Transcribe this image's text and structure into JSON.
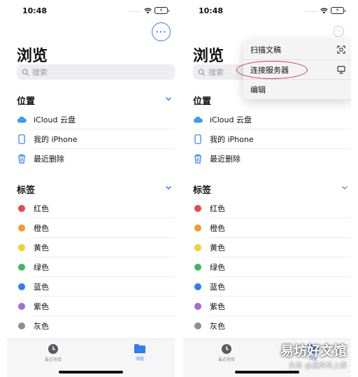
{
  "status_bar": {
    "time": "10:48",
    "signal_dots": "....."
  },
  "header": {
    "title": "浏览"
  },
  "search": {
    "placeholder": "搜索"
  },
  "locations": {
    "title": "位置",
    "items": [
      {
        "label": "iCloud 云盘",
        "icon": "cloud-icon"
      },
      {
        "label": "我的 iPhone",
        "icon": "phone-icon"
      },
      {
        "label": "最近删除",
        "icon": "trash-icon"
      }
    ]
  },
  "tags": {
    "title": "标签",
    "items": [
      {
        "label": "红色",
        "color": "#e84a4a"
      },
      {
        "label": "橙色",
        "color": "#f39a2b"
      },
      {
        "label": "黄色",
        "color": "#f5cf2a"
      },
      {
        "label": "绿色",
        "color": "#3fba5a"
      },
      {
        "label": "蓝色",
        "color": "#2f7cf6"
      },
      {
        "label": "紫色",
        "color": "#a46bd6"
      },
      {
        "label": "灰色",
        "color": "#8e8e93"
      }
    ]
  },
  "tabbar": {
    "recent_label": "最近项目",
    "browse_label": "浏览"
  },
  "menu": {
    "items": [
      {
        "label": "扫描文稿",
        "icon": "scan-icon"
      },
      {
        "label": "连接服务器",
        "icon": "monitor-icon"
      },
      {
        "label": "编辑"
      }
    ]
  },
  "watermark": {
    "main": "易坊好文馆",
    "sub": "头条 @品码马上修"
  },
  "colors": {
    "accent": "#2f7cf6",
    "highlight": "#e0323a"
  }
}
